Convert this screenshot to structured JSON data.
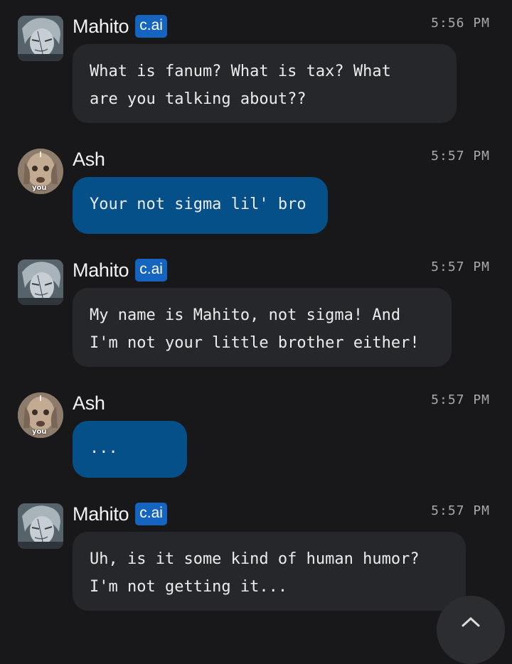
{
  "messages": [
    {
      "sender": "Mahito",
      "badge": "c.ai",
      "time": "5:56 PM",
      "text": "What is fanum? What is tax? What\nare you talking about??"
    },
    {
      "sender": "Ash",
      "you_tag": "you",
      "time": "5:57 PM",
      "text": "Your not sigma lil' bro"
    },
    {
      "sender": "Mahito",
      "badge": "c.ai",
      "time": "5:57 PM",
      "text": "My name is Mahito, not sigma! And\nI'm not your little brother either!"
    },
    {
      "sender": "Ash",
      "you_tag": "you",
      "time": "5:57 PM",
      "text": "..."
    },
    {
      "sender": "Mahito",
      "badge": "c.ai",
      "time": "5:57 PM",
      "text": "Uh, is it some kind of human humor?\nI'm not getting it..."
    }
  ],
  "colors": {
    "background": "#18181b",
    "bot_bubble": "#26272b",
    "user_bubble": "#06508a",
    "badge": "#1565c0"
  },
  "icons": {
    "scroll_button": "chevron-down-icon"
  }
}
